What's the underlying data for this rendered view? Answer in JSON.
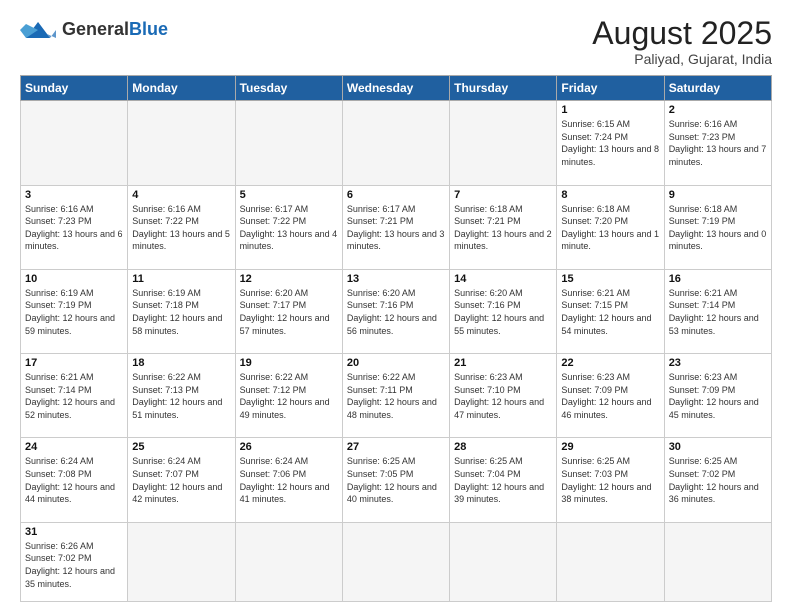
{
  "logo": {
    "general": "General",
    "blue": "Blue"
  },
  "header": {
    "month": "August 2025",
    "location": "Paliyad, Gujarat, India"
  },
  "days_of_week": [
    "Sunday",
    "Monday",
    "Tuesday",
    "Wednesday",
    "Thursday",
    "Friday",
    "Saturday"
  ],
  "weeks": [
    [
      {
        "day": "",
        "info": "",
        "empty": true
      },
      {
        "day": "",
        "info": "",
        "empty": true
      },
      {
        "day": "",
        "info": "",
        "empty": true
      },
      {
        "day": "",
        "info": "",
        "empty": true
      },
      {
        "day": "",
        "info": "",
        "empty": true
      },
      {
        "day": "1",
        "info": "Sunrise: 6:15 AM\nSunset: 7:24 PM\nDaylight: 13 hours and 8 minutes."
      },
      {
        "day": "2",
        "info": "Sunrise: 6:16 AM\nSunset: 7:23 PM\nDaylight: 13 hours and 7 minutes."
      }
    ],
    [
      {
        "day": "3",
        "info": "Sunrise: 6:16 AM\nSunset: 7:23 PM\nDaylight: 13 hours and 6 minutes."
      },
      {
        "day": "4",
        "info": "Sunrise: 6:16 AM\nSunset: 7:22 PM\nDaylight: 13 hours and 5 minutes."
      },
      {
        "day": "5",
        "info": "Sunrise: 6:17 AM\nSunset: 7:22 PM\nDaylight: 13 hours and 4 minutes."
      },
      {
        "day": "6",
        "info": "Sunrise: 6:17 AM\nSunset: 7:21 PM\nDaylight: 13 hours and 3 minutes."
      },
      {
        "day": "7",
        "info": "Sunrise: 6:18 AM\nSunset: 7:21 PM\nDaylight: 13 hours and 2 minutes."
      },
      {
        "day": "8",
        "info": "Sunrise: 6:18 AM\nSunset: 7:20 PM\nDaylight: 13 hours and 1 minute."
      },
      {
        "day": "9",
        "info": "Sunrise: 6:18 AM\nSunset: 7:19 PM\nDaylight: 13 hours and 0 minutes."
      }
    ],
    [
      {
        "day": "10",
        "info": "Sunrise: 6:19 AM\nSunset: 7:19 PM\nDaylight: 12 hours and 59 minutes."
      },
      {
        "day": "11",
        "info": "Sunrise: 6:19 AM\nSunset: 7:18 PM\nDaylight: 12 hours and 58 minutes."
      },
      {
        "day": "12",
        "info": "Sunrise: 6:20 AM\nSunset: 7:17 PM\nDaylight: 12 hours and 57 minutes."
      },
      {
        "day": "13",
        "info": "Sunrise: 6:20 AM\nSunset: 7:16 PM\nDaylight: 12 hours and 56 minutes."
      },
      {
        "day": "14",
        "info": "Sunrise: 6:20 AM\nSunset: 7:16 PM\nDaylight: 12 hours and 55 minutes."
      },
      {
        "day": "15",
        "info": "Sunrise: 6:21 AM\nSunset: 7:15 PM\nDaylight: 12 hours and 54 minutes."
      },
      {
        "day": "16",
        "info": "Sunrise: 6:21 AM\nSunset: 7:14 PM\nDaylight: 12 hours and 53 minutes."
      }
    ],
    [
      {
        "day": "17",
        "info": "Sunrise: 6:21 AM\nSunset: 7:14 PM\nDaylight: 12 hours and 52 minutes."
      },
      {
        "day": "18",
        "info": "Sunrise: 6:22 AM\nSunset: 7:13 PM\nDaylight: 12 hours and 51 minutes."
      },
      {
        "day": "19",
        "info": "Sunrise: 6:22 AM\nSunset: 7:12 PM\nDaylight: 12 hours and 49 minutes."
      },
      {
        "day": "20",
        "info": "Sunrise: 6:22 AM\nSunset: 7:11 PM\nDaylight: 12 hours and 48 minutes."
      },
      {
        "day": "21",
        "info": "Sunrise: 6:23 AM\nSunset: 7:10 PM\nDaylight: 12 hours and 47 minutes."
      },
      {
        "day": "22",
        "info": "Sunrise: 6:23 AM\nSunset: 7:09 PM\nDaylight: 12 hours and 46 minutes."
      },
      {
        "day": "23",
        "info": "Sunrise: 6:23 AM\nSunset: 7:09 PM\nDaylight: 12 hours and 45 minutes."
      }
    ],
    [
      {
        "day": "24",
        "info": "Sunrise: 6:24 AM\nSunset: 7:08 PM\nDaylight: 12 hours and 44 minutes."
      },
      {
        "day": "25",
        "info": "Sunrise: 6:24 AM\nSunset: 7:07 PM\nDaylight: 12 hours and 42 minutes."
      },
      {
        "day": "26",
        "info": "Sunrise: 6:24 AM\nSunset: 7:06 PM\nDaylight: 12 hours and 41 minutes."
      },
      {
        "day": "27",
        "info": "Sunrise: 6:25 AM\nSunset: 7:05 PM\nDaylight: 12 hours and 40 minutes."
      },
      {
        "day": "28",
        "info": "Sunrise: 6:25 AM\nSunset: 7:04 PM\nDaylight: 12 hours and 39 minutes."
      },
      {
        "day": "29",
        "info": "Sunrise: 6:25 AM\nSunset: 7:03 PM\nDaylight: 12 hours and 38 minutes."
      },
      {
        "day": "30",
        "info": "Sunrise: 6:25 AM\nSunset: 7:02 PM\nDaylight: 12 hours and 36 minutes."
      }
    ],
    [
      {
        "day": "31",
        "info": "Sunrise: 6:26 AM\nSunset: 7:02 PM\nDaylight: 12 hours and 35 minutes.",
        "last": true
      },
      {
        "day": "",
        "info": "",
        "empty": true,
        "last": true
      },
      {
        "day": "",
        "info": "",
        "empty": true,
        "last": true
      },
      {
        "day": "",
        "info": "",
        "empty": true,
        "last": true
      },
      {
        "day": "",
        "info": "",
        "empty": true,
        "last": true
      },
      {
        "day": "",
        "info": "",
        "empty": true,
        "last": true
      },
      {
        "day": "",
        "info": "",
        "empty": true,
        "last": true
      }
    ]
  ]
}
